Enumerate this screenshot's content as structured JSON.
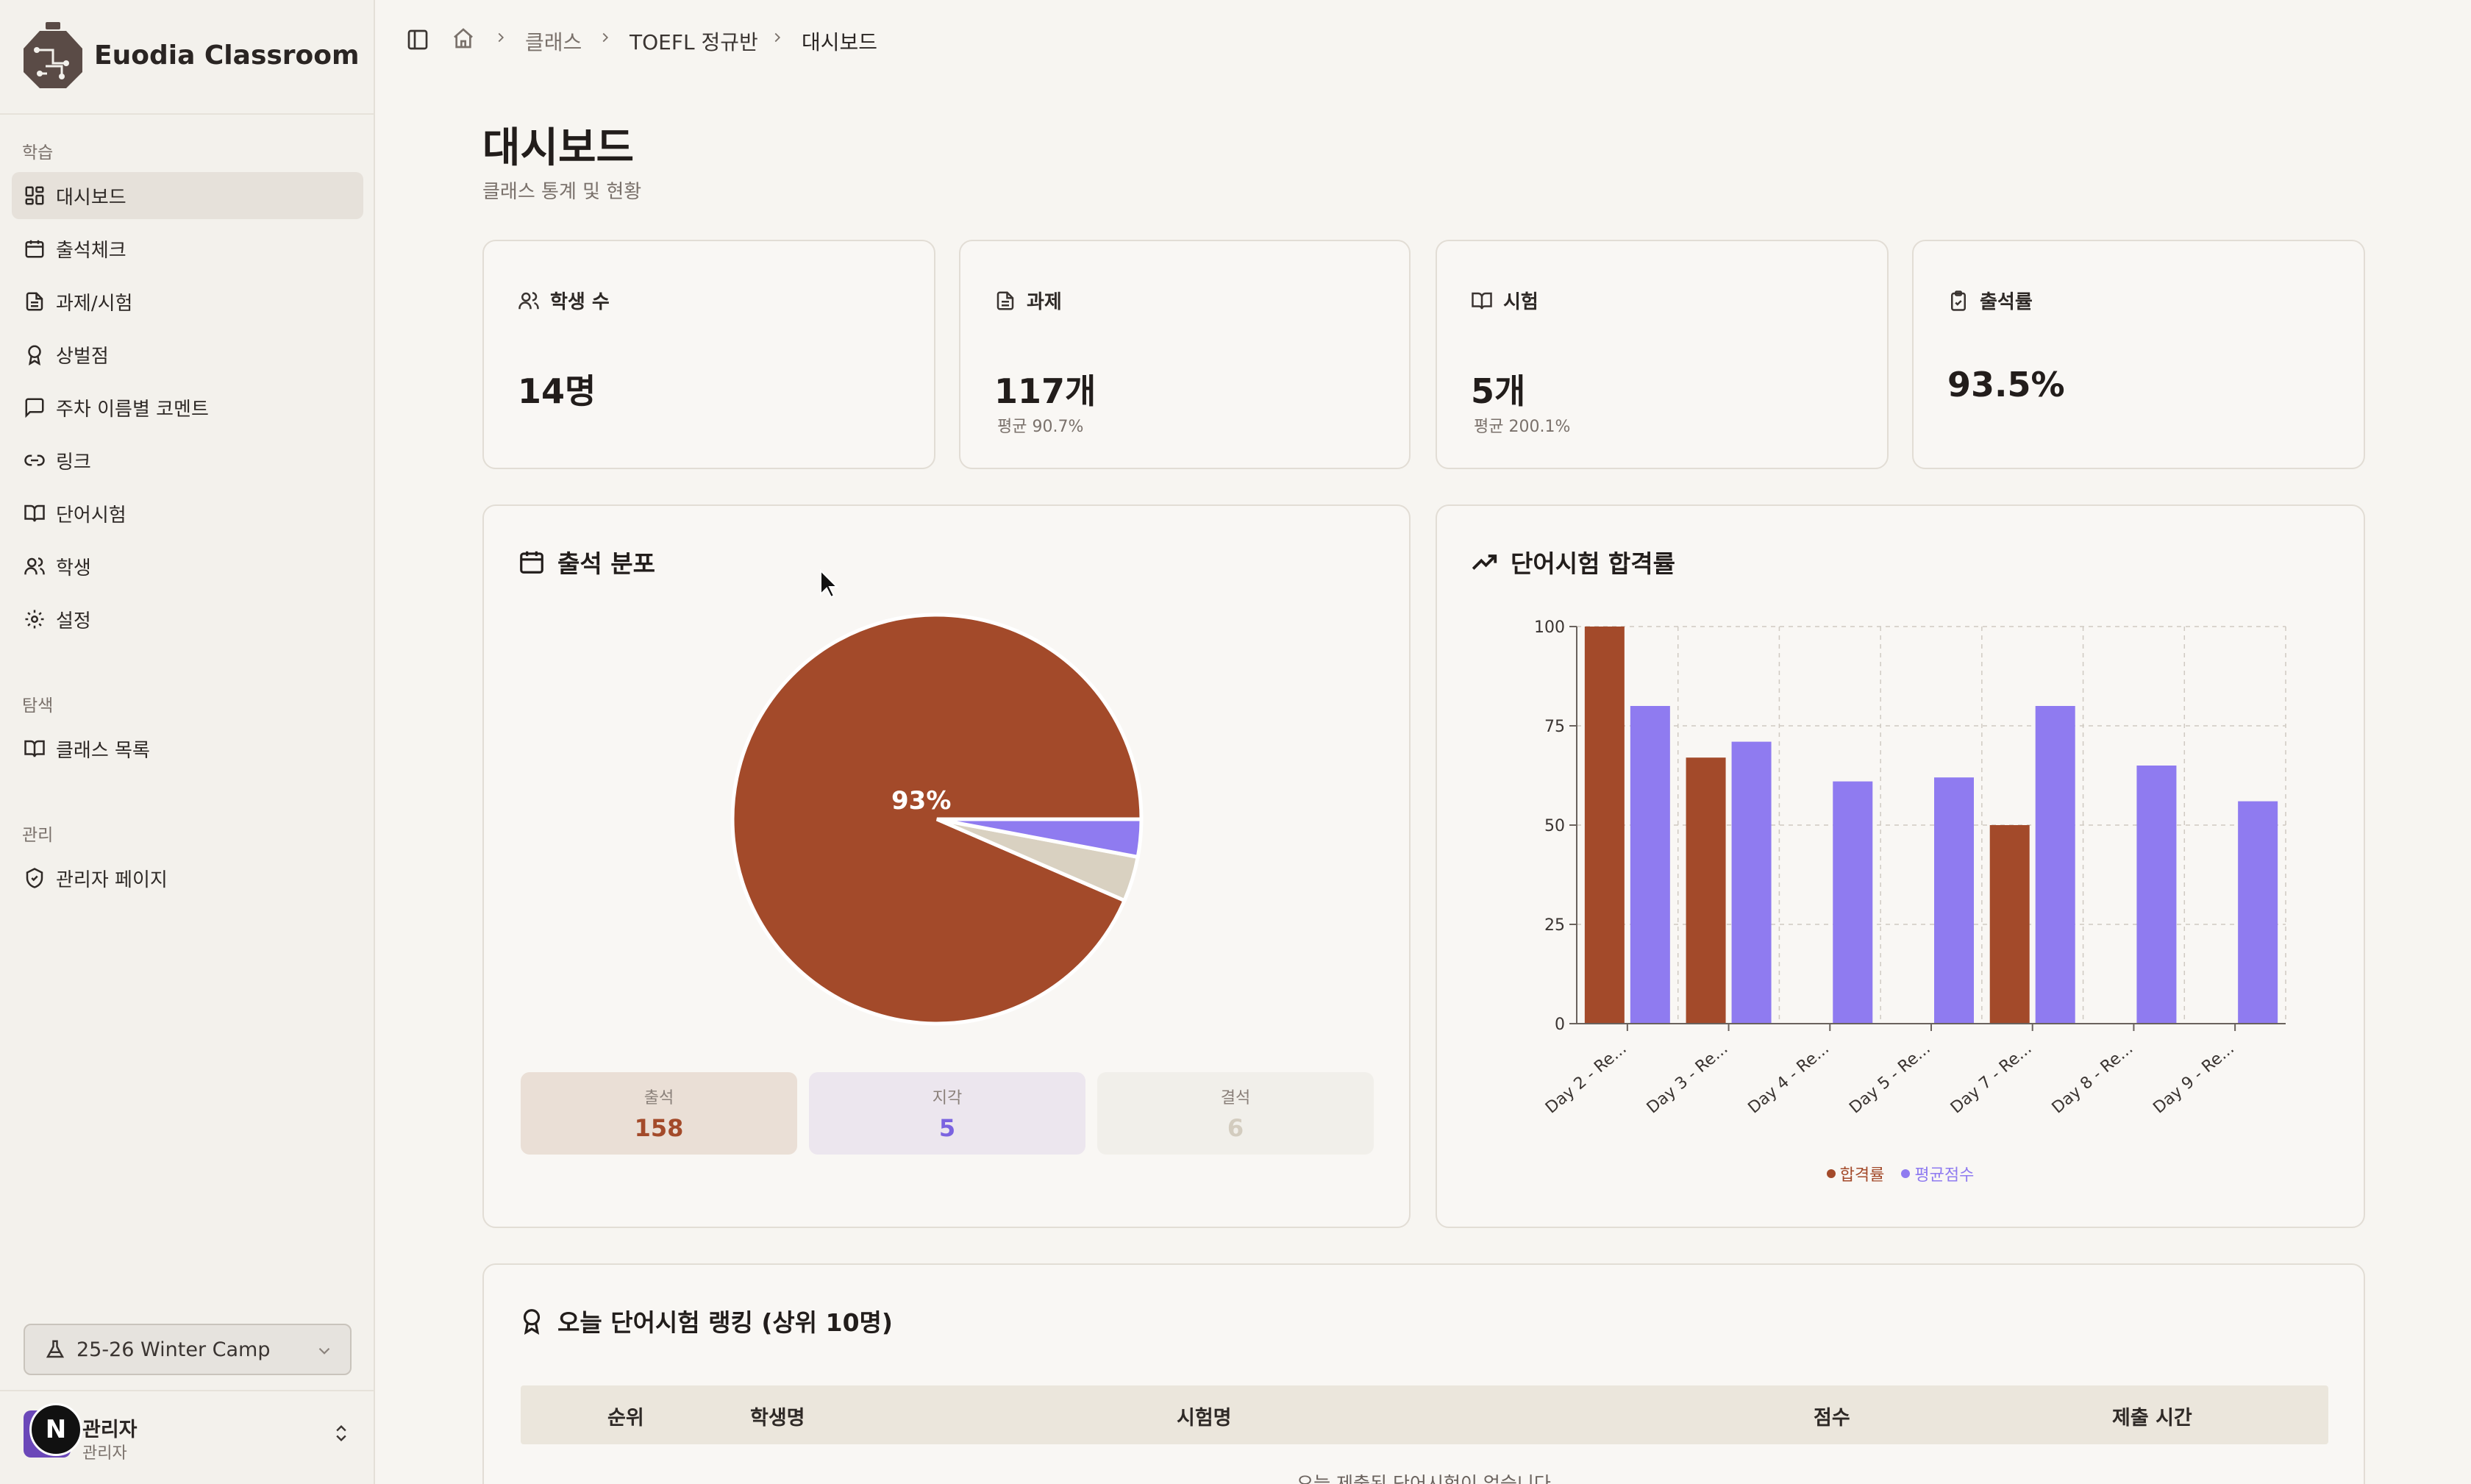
{
  "brand": {
    "name": "Euodia Classroom"
  },
  "sidebar": {
    "groups": [
      {
        "label": "학습"
      },
      {
        "label": "탐색"
      },
      {
        "label": "관리"
      }
    ],
    "items": [
      {
        "label": "대시보드",
        "icon": "dashboard-icon",
        "active": true
      },
      {
        "label": "출석체크",
        "icon": "calendar-icon"
      },
      {
        "label": "과제/시험",
        "icon": "document-icon"
      },
      {
        "label": "상벌점",
        "icon": "award-icon"
      },
      {
        "label": "주차 이름별 코멘트",
        "icon": "message-icon"
      },
      {
        "label": "링크",
        "icon": "link-icon"
      },
      {
        "label": "단어시험",
        "icon": "book-icon"
      },
      {
        "label": "학생",
        "icon": "users-icon"
      },
      {
        "label": "설정",
        "icon": "gear-icon"
      },
      {
        "label": "클래스 목록",
        "icon": "book-icon"
      },
      {
        "label": "관리자 페이지",
        "icon": "shield-icon"
      }
    ],
    "camp": {
      "label": "25-26 Winter Camp"
    },
    "user": {
      "name": "관리자",
      "role": "관리자",
      "badge": "N"
    }
  },
  "breadcrumb": {
    "items": [
      "클래스",
      "TOEFL 정규반",
      "대시보드"
    ]
  },
  "page": {
    "title": "대시보드",
    "subtitle": "클래스 통계 및 현황"
  },
  "stats": [
    {
      "label": "학생 수",
      "value": "14명",
      "note": ""
    },
    {
      "label": "과제",
      "value": "117개",
      "note": "평균 90.7%"
    },
    {
      "label": "시험",
      "value": "5개",
      "note": "평균 200.1%"
    },
    {
      "label": "출석률",
      "value": "93.5%",
      "note": ""
    }
  ],
  "attendance": {
    "title": "출석 분포",
    "pie_label": "93%",
    "boxes": [
      {
        "label": "출석",
        "value": "158"
      },
      {
        "label": "지각",
        "value": "5"
      },
      {
        "label": "결석",
        "value": "6"
      }
    ]
  },
  "vocab_chart_title": "단어시험 합격률",
  "chart_data": {
    "type": "bar",
    "categories": [
      "Day 2 - Re...",
      "Day 3 - Re...",
      "Day 4 - Re...",
      "Day 5 - Re...",
      "Day 7 - Re...",
      "Day 8 - Re...",
      "Day 9 - Re..."
    ],
    "series": [
      {
        "name": "합격률",
        "values": [
          100,
          67,
          0,
          0,
          50,
          0,
          0
        ],
        "color": "#a34a2a"
      },
      {
        "name": "평균점수",
        "values": [
          80,
          71,
          61,
          62,
          80,
          65,
          56
        ],
        "color": "#8f7bf0"
      }
    ],
    "ylim": [
      0,
      100
    ],
    "yticks": [
      "0",
      "25",
      "50",
      "75",
      "100"
    ],
    "grid": true,
    "legend": "bottom"
  },
  "ranking": {
    "title": "오늘 단어시험 랭킹 (상위 10명)",
    "columns": [
      "순위",
      "학생명",
      "시험명",
      "점수",
      "제출 시간"
    ],
    "empty": "오늘 제출된 단어시험이 없습니다"
  },
  "colors": {
    "present": "#a34a2a",
    "late": "#8f7bf0",
    "absent": "#d9d1c1"
  }
}
